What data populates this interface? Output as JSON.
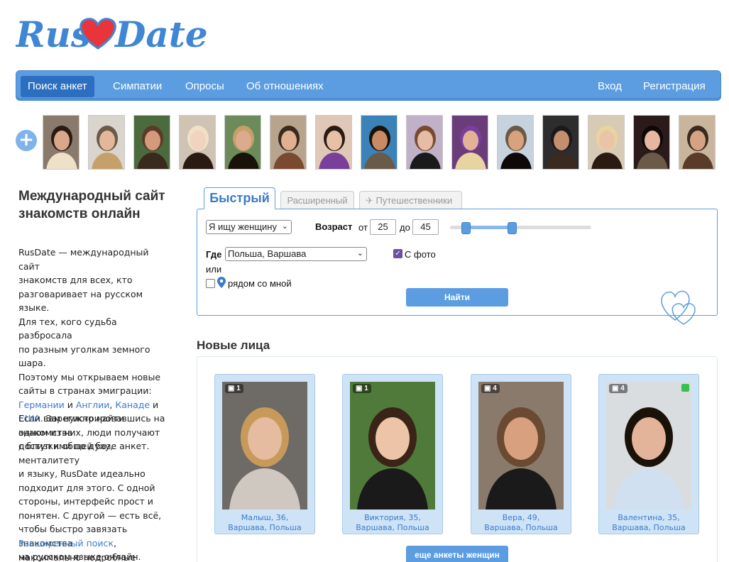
{
  "brand": {
    "name_left": "Rus",
    "name_right": "Date",
    "heart_color": "#e8343a",
    "logo_color": "#3f86d4"
  },
  "nav": {
    "left": [
      {
        "label": "Поиск анкет",
        "active": true
      },
      {
        "label": "Симпатии"
      },
      {
        "label": "Опросы"
      },
      {
        "label": "Об отношениях"
      }
    ],
    "right": [
      {
        "label": "Вход"
      },
      {
        "label": "Регистрация"
      }
    ]
  },
  "thumbnails_count": 15,
  "intro": {
    "title": "Международный сайт знакомств онлайн",
    "p1_lines": [
      "RusDate — международный сайт",
      "знакомств для всех, кто",
      "разговаривает на русском языке.",
      "Для тех, кого судьба разбросала",
      "по разным уголкам земного шара.",
      "Поэтому мы открываем новые",
      "сайты в странах эмиграции:"
    ],
    "countries": {
      "germany": "Германии",
      "and1": "и",
      "england": "Англии",
      "comma": ",",
      "canada": "Канаде",
      "and2": "и",
      "usa": "США"
    },
    "p1_tail_lines": [
      ". Зарегистрировавшись на",
      "одном из них, люди получают",
      "доступ к общей базе анкет."
    ],
    "p2_lines": [
      "Если вам нужно найти знакомства",
      "с близкими по духу, менталитету",
      "и языку, RusDate идеально",
      "подходит для этого. С одной",
      "стороны, интерфейс прост и",
      "понятен. С другой — есть всё,",
      "чтобы быстро завязать знакомства",
      "на русском языке онлайн."
    ],
    "p3_link": "Расширенный поиск",
    "p3_tail": ",",
    "p3_line2": "максимально подробные анкеты,"
  },
  "search": {
    "tabs": {
      "quick": "Быстрый",
      "extended": "Расширенный",
      "travel": "Путешественники"
    },
    "seeking_value": "Я ищу женщину",
    "age_label": "Возраст",
    "from_label": "от",
    "age_from": "25",
    "to_label": "до",
    "age_to": "45",
    "age_slider": {
      "min": 18,
      "max": 80,
      "from": 25,
      "to": 45
    },
    "where_label": "Где",
    "where_value": "Польша, Варшава",
    "with_photo_label": "С фото",
    "with_photo_checked": true,
    "or_label": "или",
    "near_me_label": "рядом со мной",
    "near_me_checked": false,
    "find_button": "Найти"
  },
  "new_faces": {
    "title": "Новые лица",
    "cards": [
      {
        "photos": "1",
        "name": "Малыш, 36,",
        "city": "Варшава, Польша",
        "online": false
      },
      {
        "photos": "1",
        "name": "Виктория, 35,",
        "city": "Варшава, Польша",
        "online": false
      },
      {
        "photos": "4",
        "name": "Вера, 49,",
        "city": "Варшава, Польша",
        "online": false
      },
      {
        "photos": "4",
        "name": "Валентина, 35,",
        "city": "Варшава, Польша",
        "online": true
      }
    ],
    "more_button": "еще анкеты женщин"
  }
}
